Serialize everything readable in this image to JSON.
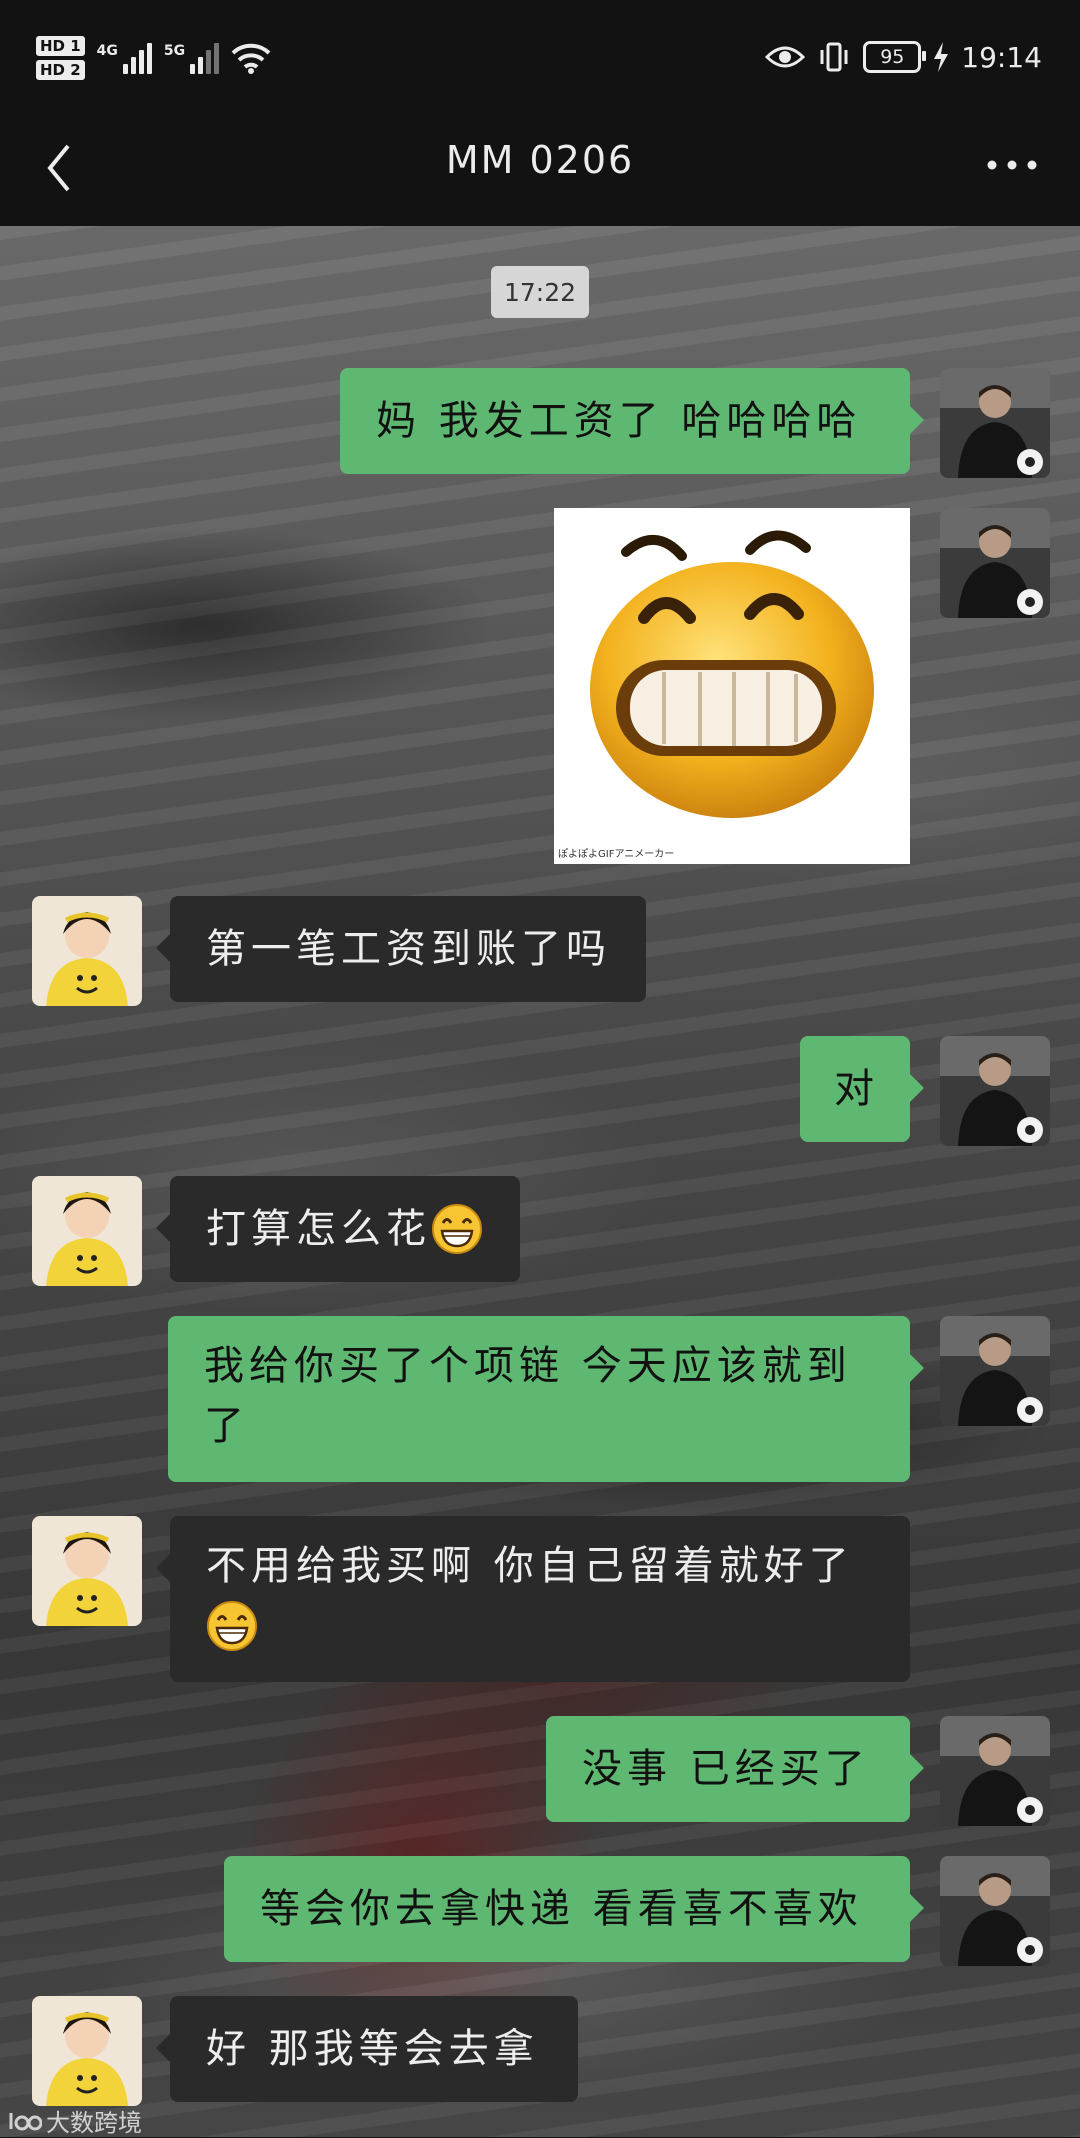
{
  "status_bar": {
    "hd1": "HD 1",
    "hd2": "HD 2",
    "net1": "4G",
    "net2": "5G",
    "battery": "95",
    "time": "19:14"
  },
  "header": {
    "title": "MM  0206"
  },
  "chat": {
    "timestamp": "17:22",
    "messages": [
      {
        "from": "me",
        "text": "妈 我发工资了 哈哈哈哈"
      },
      {
        "from": "me",
        "sticker": "grinning-face-sticker",
        "caption": "ぽよぽよGIFアニメーカー"
      },
      {
        "from": "other",
        "text": "第一笔工资到账了吗"
      },
      {
        "from": "me",
        "text": "对"
      },
      {
        "from": "other",
        "text": "打算怎么花"
      },
      {
        "from": "me",
        "line1": "我给你买了个项链 今天应该就到",
        "line2": "了"
      },
      {
        "from": "other",
        "line1": "不用给我买啊 你自己留着就好了"
      },
      {
        "from": "me",
        "text": "没事 已经买了"
      },
      {
        "from": "me",
        "text": "等会你去拿快递 看看喜不喜欢"
      },
      {
        "from": "other",
        "text": "好 那我等会去拿"
      }
    ]
  },
  "watermark": "大数跨境",
  "colors": {
    "me_bubble": "#5fb872",
    "other_bubble": "#2a2a2a",
    "bar": "#121212"
  }
}
